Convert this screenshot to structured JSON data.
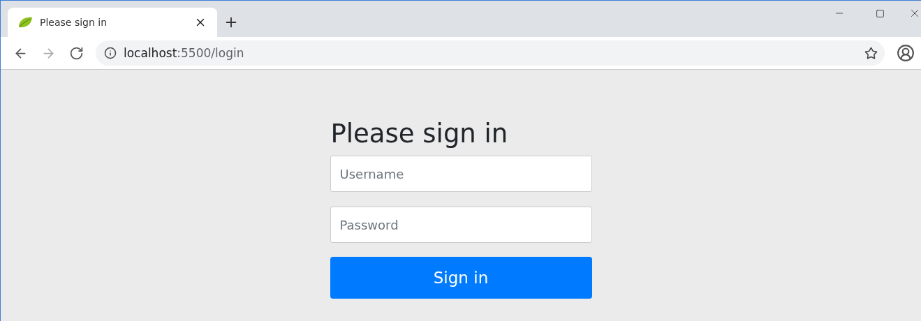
{
  "tabs": [
    {
      "title": "Please sign in",
      "selected": true
    }
  ],
  "nav_buttons": [
    {
      "kind": "back",
      "disabled": false
    },
    {
      "kind": "forward",
      "disabled": true
    },
    {
      "kind": "reload",
      "disabled": false
    }
  ],
  "address_bar": {
    "host": "localhost",
    "path": ":5500/login"
  },
  "page": {
    "heading": "Please sign in",
    "username": {
      "placeholder": "Username"
    },
    "password": {
      "placeholder": "Password"
    },
    "submit": "Sign in"
  }
}
